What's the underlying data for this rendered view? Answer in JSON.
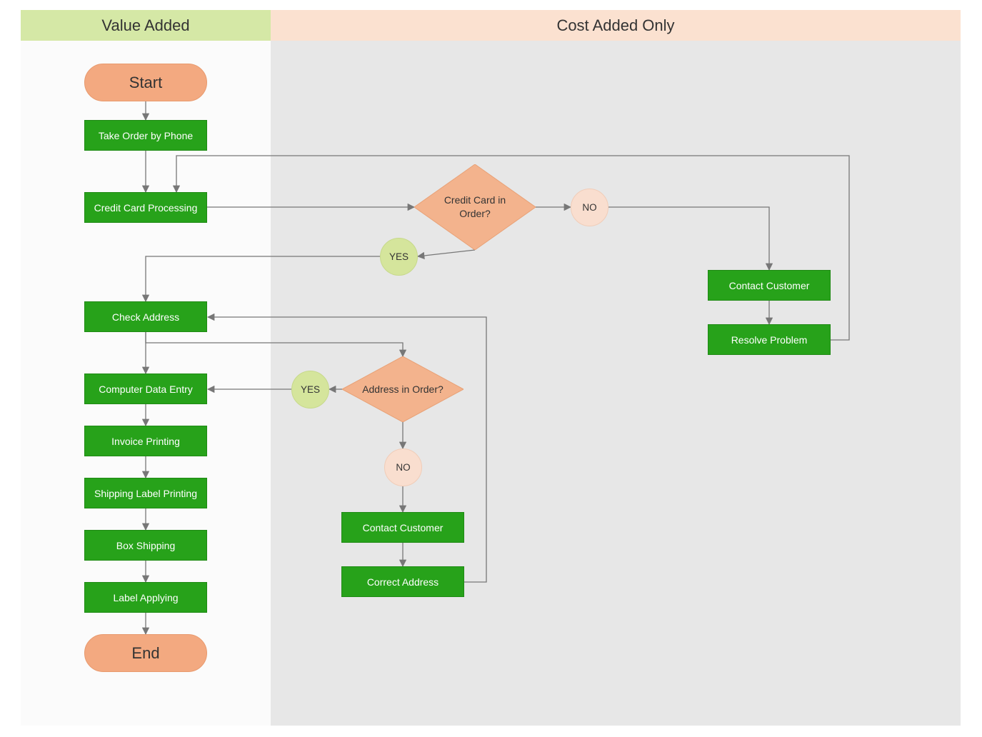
{
  "lanes": {
    "left_label": "Value Added",
    "right_label": "Cost Added Only"
  },
  "terminators": {
    "start": "Start",
    "end": "End"
  },
  "processes": {
    "take_order": "Take Order by Phone",
    "cc_processing": "Credit Card Processing",
    "check_address": "Check Address",
    "data_entry": "Computer Data Entry",
    "invoice": "Invoice Printing",
    "shipping_label": "Shipping Label Printing",
    "box_shipping": "Box Shipping",
    "label_applying": "Label Applying",
    "contact_customer_cc": "Contact Customer",
    "resolve_problem": "Resolve Problem",
    "contact_customer_addr": "Contact Customer",
    "correct_address": "Correct Address"
  },
  "decisions": {
    "cc_in_order": "Credit Card in Order?",
    "addr_in_order": "Address in Order?"
  },
  "outcomes": {
    "yes": "YES",
    "no": "NO"
  },
  "colors": {
    "process": "#27a21a",
    "terminator": "#f3a980",
    "decision": "#f3b38d",
    "yes": "#d5e59c",
    "no": "#f9decf",
    "lane_left": "#d5e8a6",
    "lane_right": "#fbe1d0"
  }
}
